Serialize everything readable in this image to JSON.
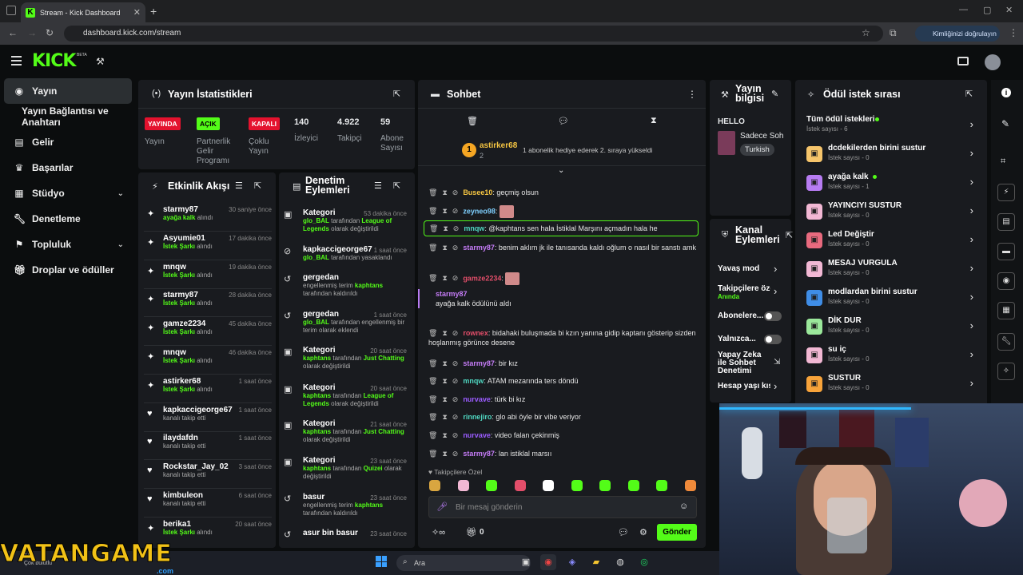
{
  "browser": {
    "tab_title": "Stream - Kick Dashboard",
    "url": "dashboard.kick.com/stream",
    "verify_label": "Kimliğinizi doğrulayın"
  },
  "header": {
    "logo": "KICK",
    "beta": "BETA"
  },
  "sidebar": {
    "items": [
      {
        "label": "Yayın",
        "icon": "broadcast-icon"
      },
      {
        "label": "Yayın Bağlantısı ve Anahtarı",
        "icon": ""
      },
      {
        "label": "Gelir",
        "icon": "chart-icon"
      },
      {
        "label": "Başarılar",
        "icon": "trophy-icon"
      },
      {
        "label": "Stüdyo",
        "icon": "studio-icon"
      },
      {
        "label": "Denetleme",
        "icon": "wrench-icon"
      },
      {
        "label": "Topluluk",
        "icon": "community-icon"
      },
      {
        "label": "Droplar ve ödüller",
        "icon": "gift-icon"
      }
    ]
  },
  "stats": {
    "title": "Yayın İstatistikleri",
    "cells": [
      {
        "badge": "YAYINDA",
        "badge_color": "#e4122e",
        "label": "Yayın"
      },
      {
        "badge": "AÇIK",
        "badge_color": "#53fc18",
        "label": "Partnerlik Gelir Programı"
      },
      {
        "badge": "KAPALI",
        "badge_color": "#e4122e",
        "label": "Çoklu Yayın"
      },
      {
        "value": "140",
        "label": "İzleyici"
      },
      {
        "value": "4.922",
        "label": "Takipçi"
      },
      {
        "value": "59",
        "label": "Abone Sayısı"
      }
    ]
  },
  "activity": {
    "title": "Etkinlik Akışı",
    "items": [
      {
        "name": "starmy87",
        "time": "30 saniye önce",
        "action": "ayağa kalk",
        "suffix": "alındı",
        "icon": "reward-icon"
      },
      {
        "name": "Asyumie01",
        "time": "17 dakika önce",
        "action": "İstek Şarkı",
        "suffix": "alındı",
        "icon": "reward-icon"
      },
      {
        "name": "mnqw",
        "time": "19 dakika önce",
        "action": "İstek Şarkı",
        "suffix": "alındı",
        "icon": "reward-icon"
      },
      {
        "name": "starmy87",
        "time": "28 dakika önce",
        "action": "İstek Şarkı",
        "suffix": "alındı",
        "icon": "reward-icon"
      },
      {
        "name": "gamze2234",
        "time": "45 dakika önce",
        "action": "İstek Şarkı",
        "suffix": "alındı",
        "icon": "reward-icon"
      },
      {
        "name": "mnqw",
        "time": "46 dakika önce",
        "action": "İstek Şarkı",
        "suffix": "alındı",
        "icon": "reward-icon"
      },
      {
        "name": "astirker68",
        "time": "1 saat önce",
        "action": "İstek Şarkı",
        "suffix": "alındı",
        "icon": "reward-icon"
      },
      {
        "name": "kapkaccigeorge67",
        "time": "1 saat önce",
        "action": "",
        "suffix": "kanalı takip etti",
        "icon": "heart-icon"
      },
      {
        "name": "ilaydafdn",
        "time": "1 saat önce",
        "action": "",
        "suffix": "kanalı takip etti",
        "icon": "heart-icon"
      },
      {
        "name": "Rockstar_Jay_02",
        "time": "3 saat önce",
        "action": "",
        "suffix": "kanalı takip etti",
        "icon": "heart-icon"
      },
      {
        "name": "kimbuleon",
        "time": "6 saat önce",
        "action": "",
        "suffix": "kanalı takip etti",
        "icon": "heart-icon"
      },
      {
        "name": "berika1",
        "time": "20 saat önce",
        "action": "İstek Şarkı",
        "suffix": "alındı",
        "icon": "reward-icon"
      }
    ]
  },
  "moderation": {
    "title": "Denetim Eylemleri",
    "items": [
      {
        "name": "Kategori",
        "time": "53 dakika önce",
        "l1a": "glo_BAL",
        "l1b": " tarafından ",
        "l1c": "League of Legends",
        "l1d": " olarak değiştirildi"
      },
      {
        "name": "kapkaccigeorge67",
        "time": "1 saat önce",
        "l1a": "glo_BAL",
        "l1b": " tarafından yasaklandı",
        "l1c": "",
        "l1d": ""
      },
      {
        "name": "gergedan",
        "time": "",
        "l1a": "",
        "l1b": "engellenmiş terim ",
        "l1c": "kaphtans",
        "l1d": " tarafından kaldırıldı"
      },
      {
        "name": "gergedan",
        "time": "1 saat önce",
        "l1a": "glo_BAL",
        "l1b": " tarafından engellenmiş bir terim olarak eklendi",
        "l1c": "",
        "l1d": ""
      },
      {
        "name": "Kategori",
        "time": "20 saat önce",
        "l1a": "kaphtans",
        "l1b": " tarafından ",
        "l1c": "Just Chatting",
        "l1d": " olarak değiştirildi"
      },
      {
        "name": "Kategori",
        "time": "20 saat önce",
        "l1a": "kaphtans",
        "l1b": " tarafından ",
        "l1c": "League of Legends",
        "l1d": " olarak değiştirildi"
      },
      {
        "name": "Kategori",
        "time": "21 saat önce",
        "l1a": "kaphtans",
        "l1b": " tarafından ",
        "l1c": "Just Chatting",
        "l1d": " olarak değiştirildi"
      },
      {
        "name": "Kategori",
        "time": "23 saat önce",
        "l1a": "kaphtans",
        "l1b": " tarafından ",
        "l1c": "Quizei",
        "l1d": " olarak değiştirildi"
      },
      {
        "name": "basur",
        "time": "23 saat önce",
        "l1a": "",
        "l1b": "engellenmiş terim ",
        "l1c": "kaphtans",
        "l1d": " tarafından kaldırıldı"
      },
      {
        "name": "asur bin basur",
        "time": "23 saat önce",
        "l1a": "",
        "l1b": "",
        "l1c": "",
        "l1d": ""
      }
    ]
  },
  "chat": {
    "title": "Sohbet",
    "pinned_user": "astirker68",
    "pinned_count": "2",
    "pinned_text": "1 abonelik hediye ederek 2. sıraya yükseldi",
    "messages": [
      {
        "user": "Busee10",
        "text": "geçmiş olsun",
        "color": "u-y"
      },
      {
        "user": "zeyneo98",
        "text": "",
        "color": "u-b"
      },
      {
        "user": "mnqw",
        "text": "@kaphtans sen hala İstiklal Marşını açmadın hala he",
        "color": "u-c"
      },
      {
        "user": "starmy87",
        "text": "benim aklım jk ile tanısanda kaldı oğlum o nasıl bir sanstı amk",
        "color": "u-p"
      },
      {
        "user": "gamze2234",
        "text": "",
        "color": "u-r"
      },
      {
        "user": "starmy87",
        "text": "ayağa kalk ödülünü aldı",
        "color": "u-p"
      },
      {
        "user": "rownex",
        "text": "bidahaki buluşmada bi kzın yanına gidip kaptanı gösterip sizden hoşlanmış görünce desene",
        "color": "u-r"
      },
      {
        "user": "starmy87",
        "text": "bir kız",
        "color": "u-p"
      },
      {
        "user": "mnqw",
        "text": "ATAM mezarında ters döndü",
        "color": "u-c"
      },
      {
        "user": "nurvave",
        "text": "türk bi kız",
        "color": "u-v"
      },
      {
        "user": "rinnejiro",
        "text": "glo abi öyle bir vibe veriyor",
        "color": "u-c"
      },
      {
        "user": "nurvave",
        "text": "video falan çekinmiş",
        "color": "u-v"
      },
      {
        "user": "starmy87",
        "text": "lan istiklal marsıı",
        "color": "u-p"
      }
    ],
    "emote_label": "Takipçilere Özel",
    "input_placeholder": "Bir mesaj gönderin",
    "send_label": "Gönder",
    "count": "0"
  },
  "stream_info": {
    "title": "Yayın bilgisi",
    "stream_title": "HELLO",
    "category": "Sadece Soh",
    "tag": "Turkish"
  },
  "channel_actions": {
    "title": "Kanal Eylemleri",
    "items": [
      {
        "label": "Yavaş mod",
        "sub": ""
      },
      {
        "label": "Takipçilere öze",
        "sub": "Anında"
      },
      {
        "label": "Abonelere...",
        "sub": ""
      },
      {
        "label": "Yalnızca...",
        "sub": ""
      },
      {
        "label": "Yapay Zeka ile Sohbet Denetimi",
        "sub": ""
      },
      {
        "label": "Hesap yaşı kıs",
        "sub": ""
      }
    ]
  },
  "rewards": {
    "title": "Ödül istek sırası",
    "items": [
      {
        "name": "Tüm ödül istekleri",
        "count": "İstek sayısı - 6",
        "color": ""
      },
      {
        "name": "dcdekilerden birini sustur",
        "count": "İstek sayısı - 0",
        "color": "#f6c56b"
      },
      {
        "name": "ayağa kalk",
        "count": "İstek sayısı - 1",
        "color": "#b77cf2"
      },
      {
        "name": "YAYINCIYI SUSTUR",
        "count": "İstek sayısı - 0",
        "color": "#f2b8d4"
      },
      {
        "name": "Led Değiştir",
        "count": "İstek sayısı - 0",
        "color": "#e86a7e"
      },
      {
        "name": "MESAJ VURGULA",
        "count": "İstek sayısı - 0",
        "color": "#f2b8d4"
      },
      {
        "name": "modlardan birini sustur",
        "count": "İstek sayısı - 0",
        "color": "#3f8de6"
      },
      {
        "name": "DİK DUR",
        "count": "İstek sayısı - 0",
        "color": "#9be89b"
      },
      {
        "name": "su iç",
        "count": "İstek sayısı - 0",
        "color": "#f2b8d4"
      },
      {
        "name": "SUSTUR",
        "count": "İstek sayısı - 0",
        "color": "#f7a33a"
      }
    ]
  },
  "taskbar": {
    "search": "Ara",
    "watermark": "VATANGAME",
    "watermark_sub": ".com",
    "weather": "12",
    "weather_sub": "Çok bulutlu"
  }
}
